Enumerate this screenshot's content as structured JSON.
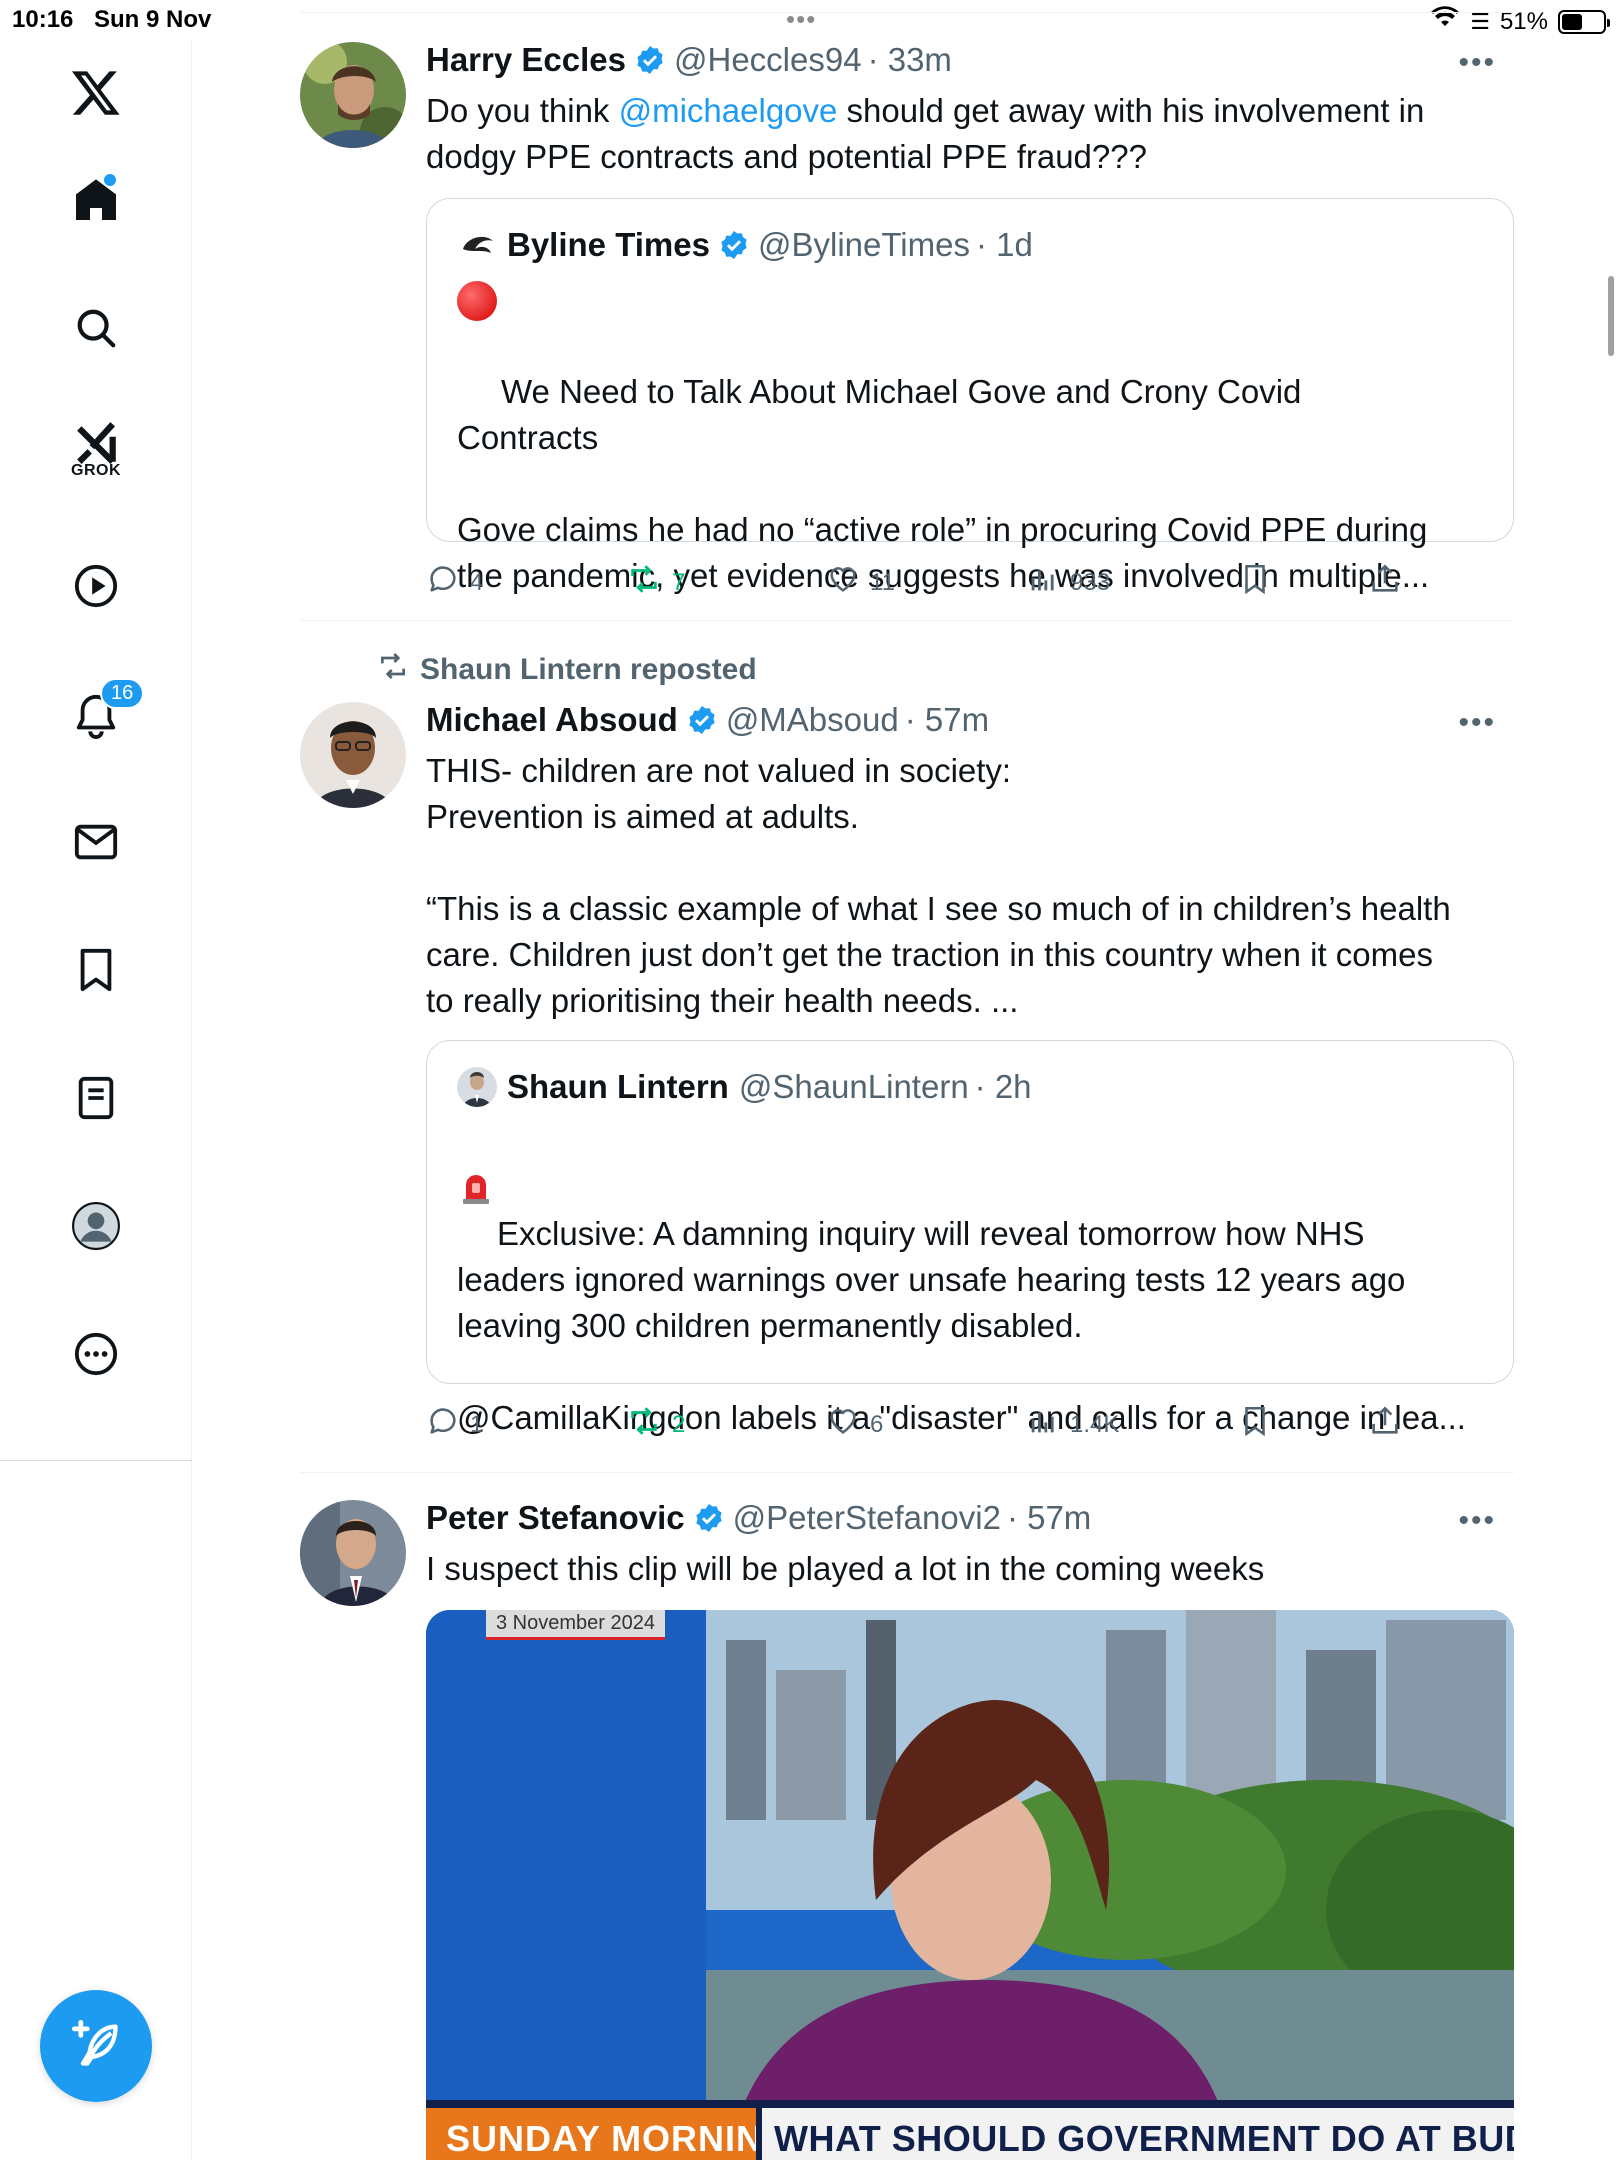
{
  "status_bar": {
    "time": "10:16",
    "date": "Sun 9 Nov",
    "battery": "51%",
    "battery_level": 0.51
  },
  "sidebar": {
    "items": [
      {
        "name": "home",
        "has_dot": true
      },
      {
        "name": "search"
      },
      {
        "name": "grok",
        "label": "GROK"
      },
      {
        "name": "video"
      },
      {
        "name": "notifications",
        "badge": "16"
      },
      {
        "name": "messages"
      },
      {
        "name": "bookmarks"
      },
      {
        "name": "lists"
      },
      {
        "name": "profile"
      },
      {
        "name": "more"
      }
    ]
  },
  "colors": {
    "accent": "#1d9bf0",
    "retweet_green": "#00ba7c",
    "muted": "#536471",
    "border": "#cfd9de"
  },
  "tweets": [
    {
      "author": "Harry Eccles",
      "handle": "@Heccles94",
      "time": "· 33m",
      "text_before": "Do you think ",
      "mention": "@michaelgove",
      "text_after": " should get away with his involvement in\ndodgy PPE contracts and potential PPE fraud???",
      "quote": {
        "author": "Byline Times",
        "handle": "@BylineTimes",
        "time": "· 1d",
        "text": "We Need to Talk About Michael Gove and Crony Covid\nContracts\n\nGove claims he had no “active role” in procuring Covid PPE during\nthe pandemic, yet evidence suggests he was involved in multiple..."
      },
      "stats": {
        "replies": "4",
        "reposts": "7",
        "likes": "11",
        "views": "933"
      }
    },
    {
      "repost_by": "Shaun Lintern reposted",
      "author": "Michael Absoud",
      "handle": "@MAbsoud",
      "time": "· 57m",
      "text": "THIS- children are not valued in society:\nPrevention is aimed at adults.\n\n“This is a classic example of what I see so much of in children’s health\ncare. Children just don’t get the traction in this country when it comes\nto really prioritising their health needs. ...",
      "quote": {
        "author": "Shaun Lintern",
        "handle": "@ShaunLintern",
        "time": "· 2h",
        "text": " Exclusive: A damning inquiry will reveal tomorrow how NHS\nleaders ignored warnings over unsafe hearing tests 12 years ago\nleaving 300 children permanently disabled.\n\n@CamillaKingdon labels it a \"disaster\" and calls for a change in lea..."
      },
      "stats": {
        "replies": "1",
        "reposts": "2",
        "likes": "6",
        "views": "1.4K"
      }
    },
    {
      "author": "Peter Stefanovic",
      "handle": "@PeterStefanovi2",
      "time": "· 57m",
      "text": "I suspect this clip will be played a lot in the coming weeks",
      "media": {
        "date_tag": "3 November 2024",
        "ticker_left": "SUNDAY MORNING",
        "ticker_right": "WHAT SHOULD GOVERNMENT DO AT BUDGET?"
      }
    }
  ]
}
